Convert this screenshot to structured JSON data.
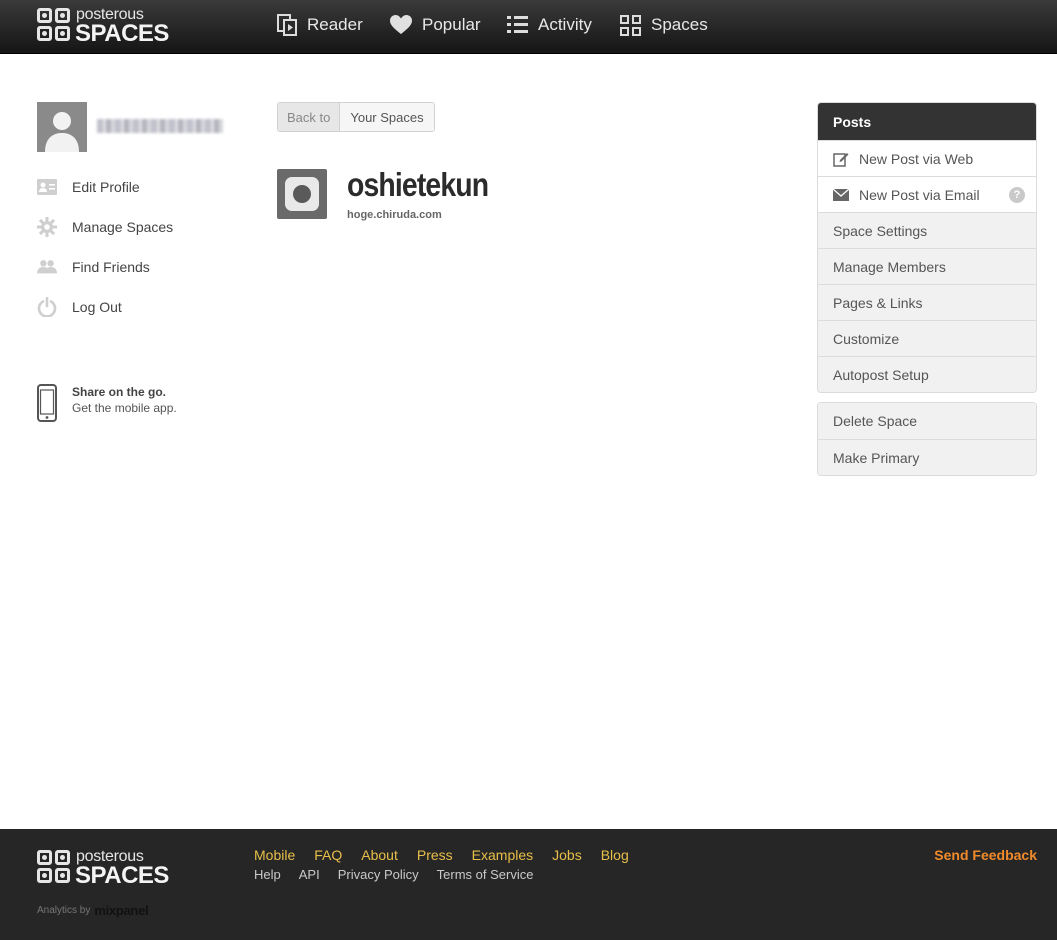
{
  "header": {
    "logo": {
      "small": "posterous",
      "big": "SPACES"
    },
    "nav": [
      {
        "label": "Reader",
        "icon": "reader-icon"
      },
      {
        "label": "Popular",
        "icon": "heart-icon"
      },
      {
        "label": "Activity",
        "icon": "list-icon"
      },
      {
        "label": "Spaces",
        "icon": "grid-icon"
      }
    ]
  },
  "sidebar": {
    "links": [
      {
        "label": "Edit Profile",
        "icon": "id-card-icon"
      },
      {
        "label": "Manage Spaces",
        "icon": "gear-icon"
      },
      {
        "label": "Find Friends",
        "icon": "friends-icon"
      },
      {
        "label": "Log Out",
        "icon": "power-icon"
      }
    ],
    "mobile": {
      "title": "Share on the go.",
      "subtitle": "Get the mobile app."
    }
  },
  "main": {
    "back": {
      "prefix": "Back to",
      "target": "Your Spaces"
    },
    "space": {
      "title": "oshietekun",
      "url": "hoge.chiruda.com"
    }
  },
  "panel": {
    "header": "Posts",
    "post_actions": [
      {
        "label": "New Post via Web",
        "icon": "edit-icon"
      },
      {
        "label": "New Post via Email",
        "icon": "envelope-icon",
        "help": "?"
      }
    ],
    "settings": [
      "Space Settings",
      "Manage Members",
      "Pages & Links",
      "Customize",
      "Autopost Setup"
    ],
    "danger": [
      "Delete Space",
      "Make Primary"
    ]
  },
  "footer": {
    "logo": {
      "small": "posterous",
      "big": "SPACES"
    },
    "links_primary": [
      "Mobile",
      "FAQ",
      "About",
      "Press",
      "Examples",
      "Jobs",
      "Blog"
    ],
    "links_secondary": [
      "Help",
      "API",
      "Privacy Policy",
      "Terms of Service"
    ],
    "feedback": "Send Feedback",
    "analytics_prefix": "Analytics by",
    "analytics_brand": "mixpanel"
  },
  "colors": {
    "footer_link": "#e8bf4a",
    "feedback": "#f08a2a",
    "panel_head": "#333333"
  }
}
